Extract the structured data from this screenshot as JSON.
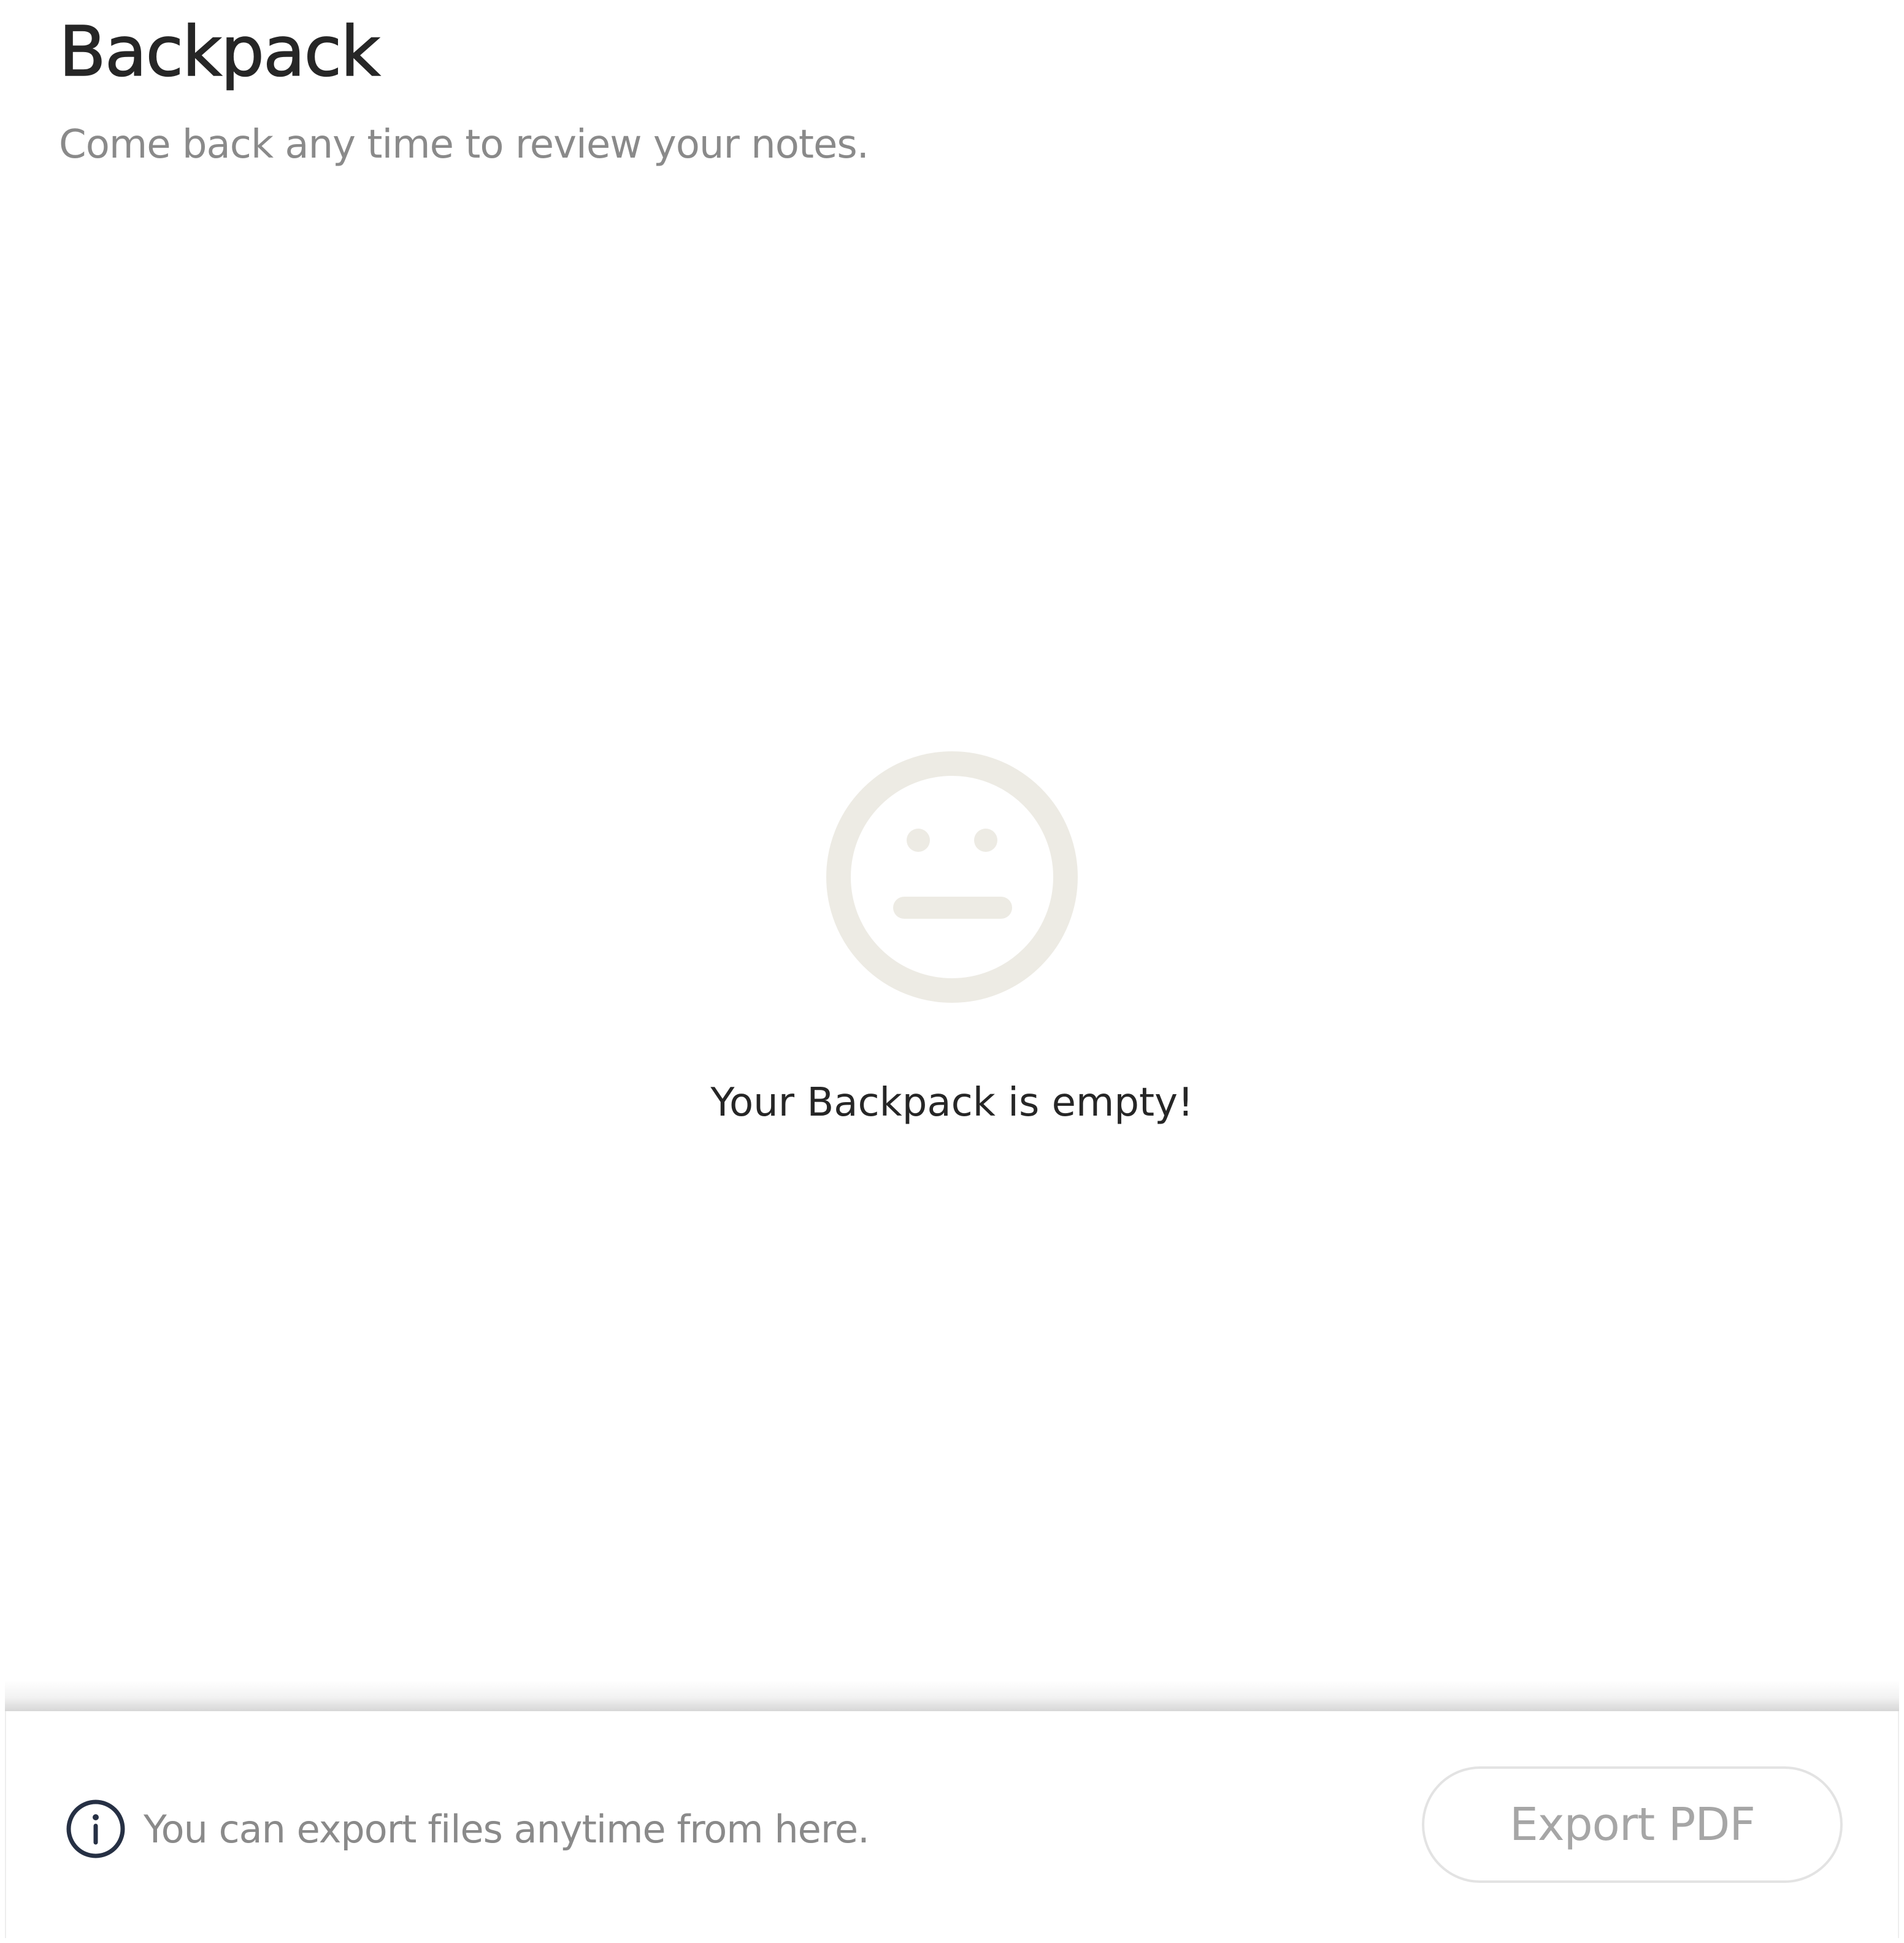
{
  "header": {
    "title": "Backpack",
    "subtitle": "Come back any time to review your notes."
  },
  "empty_state": {
    "icon": "neutral-face-icon",
    "icon_color": "#edebe4",
    "message": "Your Backpack is empty!"
  },
  "footer": {
    "icon": "info-icon",
    "icon_color": "#263044",
    "info_text": "You can export files anytime from here.",
    "export_button_label": "Export PDF"
  }
}
